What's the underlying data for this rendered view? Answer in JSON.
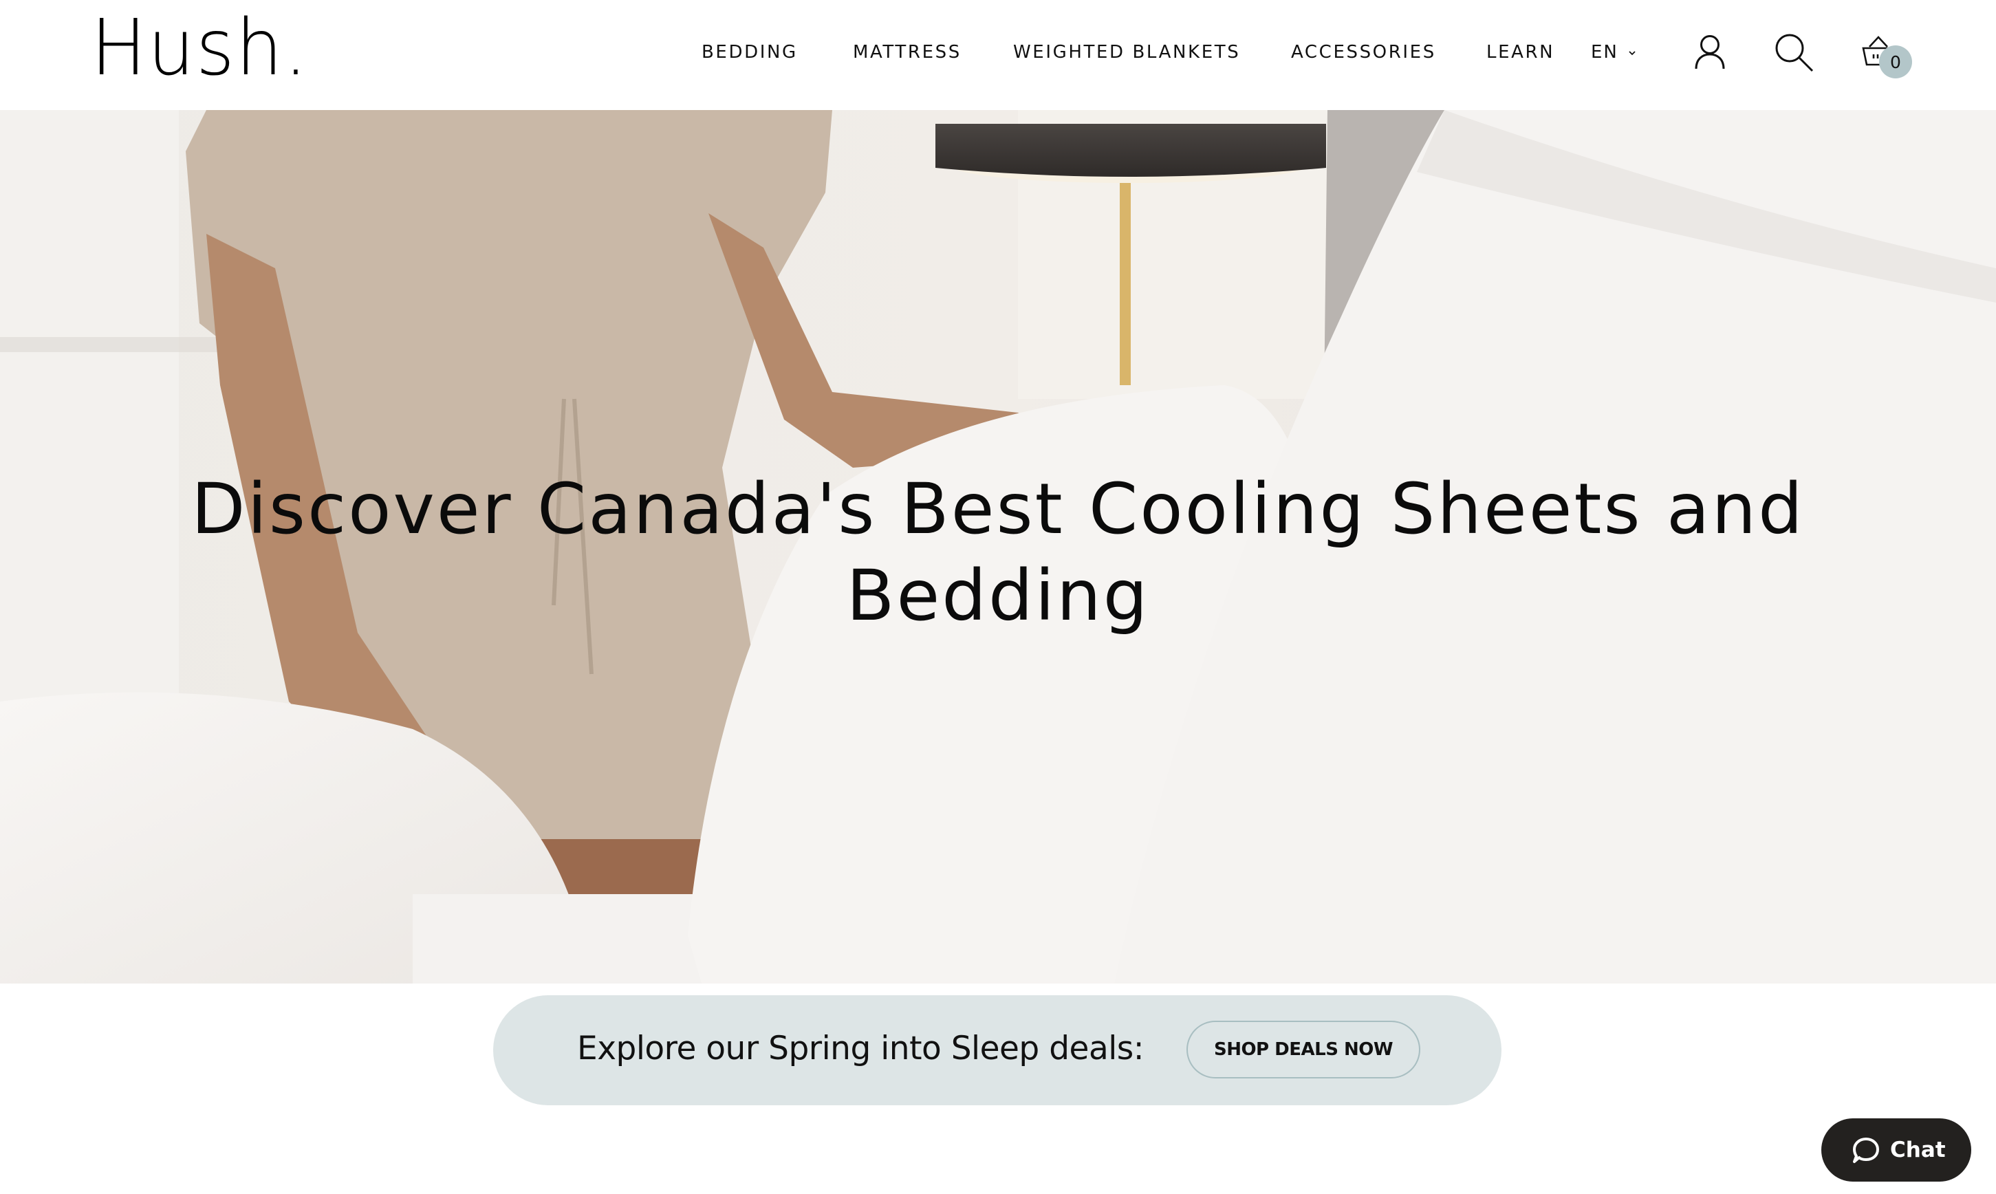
{
  "brand": {
    "logo_text": "Hush."
  },
  "nav": {
    "items": [
      {
        "label": "BEDDING"
      },
      {
        "label": "MATTRESS"
      },
      {
        "label": "WEIGHTED BLANKETS"
      },
      {
        "label": "ACCESSORIES"
      },
      {
        "label": "LEARN"
      }
    ],
    "language": {
      "label": "EN",
      "icon": "chevron-down-icon"
    },
    "icons": {
      "account": "user-icon",
      "search": "search-icon",
      "cart": "basket-icon"
    },
    "cart_count": "0"
  },
  "hero": {
    "title_line1": "Discover Canada's Best Cooling Sheets and",
    "title_line2": "Bedding"
  },
  "promo": {
    "text": "Explore our Spring into Sleep deals:",
    "button_label": "SHOP DEALS NOW"
  },
  "chat": {
    "label": "Chat",
    "icon": "chat-bubble-icon"
  },
  "colors": {
    "promo_background": "#dde5e6",
    "promo_button_border": "#a8bec1",
    "cart_badge": "#b3c6c9",
    "chat_background": "#23211f"
  }
}
